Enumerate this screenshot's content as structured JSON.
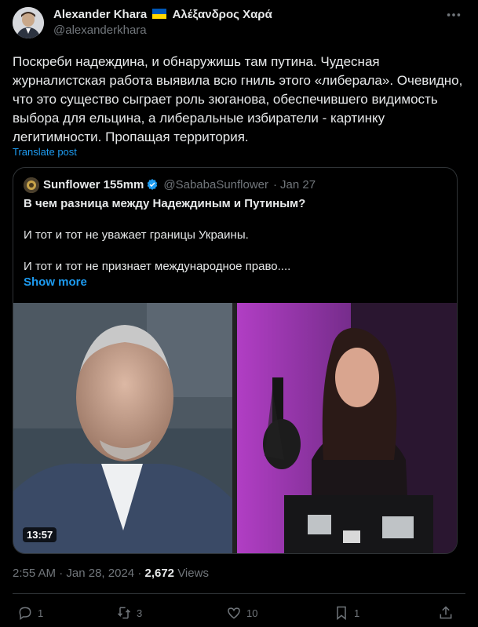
{
  "author": {
    "name": "Alexander Khara",
    "name_greek": "Αλέξανδρος Χαρά",
    "handle": "@alexanderkhara"
  },
  "tweet": {
    "lines": [
      "Поскреби надеждина, и обнаружишь там путина. Чудесная",
      "журналистская работа выявила всю гниль этого «либерала». Очевидно,",
      "что это существо сыграет роль зюганова, обеспечившего видимость",
      "выбора для ельцина, а либеральные избиратели - картинку",
      "легитимности. Пропащая территория."
    ],
    "translate_label": "Translate post"
  },
  "quote": {
    "name": "Sunflower 155mm",
    "handle": "@SababaSunflower",
    "date": "Jan 27",
    "line1": "В чем разница между Надеждиным и Путиным?",
    "line2": "И тот и тот не уважает границы Украины.",
    "line3": "И тот и тот не признает международное право....",
    "show_more": "Show more",
    "video_duration": "13:57"
  },
  "meta": {
    "time": "2:55 AM",
    "date": "Jan 28, 2024",
    "views_count": "2,672",
    "views_label": "Views"
  },
  "actions": {
    "replies": "1",
    "reposts": "3",
    "likes": "10",
    "bookmarks": "1"
  },
  "colors": {
    "background": "#000000",
    "accent": "#1d9bf0",
    "muted": "#71767b",
    "text": "#e7e9ea"
  }
}
